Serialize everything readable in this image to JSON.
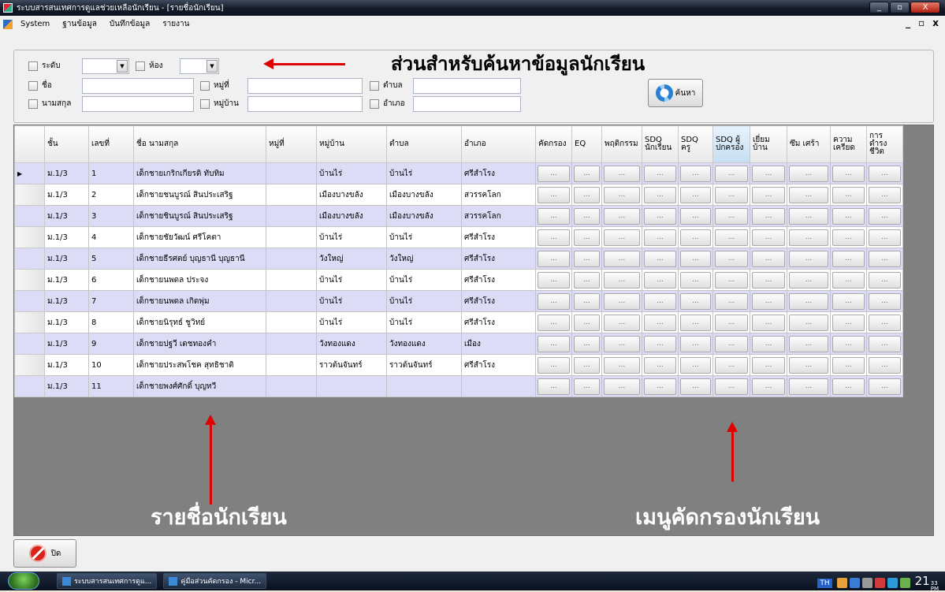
{
  "window": {
    "title": "ระบบสารสนเทศการดูแลช่วยเหลือนักเรียน - [รายชื่อนักเรียน]",
    "min_label": "_",
    "max_label": "▫",
    "close_label": "X"
  },
  "menubar": {
    "items": [
      "System",
      "ฐานข้อมูล",
      "บันทึกข้อมูล",
      "รายงาน"
    ],
    "mdi_min": "_",
    "mdi_restore": "▫",
    "mdi_close": "x"
  },
  "search": {
    "level_label": "ระดับ",
    "room_label": "ห้อง",
    "name_label": "ชื่อ",
    "moo_label": "หมู่ที่",
    "tambon_label": "ตำบล",
    "surname_label": "นามสกุล",
    "village_label": "หมู่บ้าน",
    "amphoe_label": "อำเภอ",
    "search_button": "ค้นหา"
  },
  "annotations": {
    "search_note": "ส่วนสำหรับค้นหาข้อมูลนักเรียน",
    "list_note": "รายชื่อนักเรียน",
    "filter_note": "เมนูคัดกรองนักเรียน"
  },
  "grid": {
    "columns": [
      "ชั้น",
      "เลขที่",
      "ชื่อ นามสกุล",
      "หมู่ที่",
      "หมู่บ้าน",
      "ตำบล",
      "อำเภอ",
      "คัดกรอง",
      "EQ",
      "พฤติกรรม",
      "SDQ นักเรียน",
      "SDQ ครู",
      "SDQ ผู้ปกครอง",
      "เยี่ยม บ้าน",
      "ซึม เศร้า",
      "ความ เครียด",
      "การ ดำรง ชีวิต"
    ],
    "button_label": "...",
    "rows": [
      {
        "grade": "ม.1/3",
        "no": "1",
        "name": "เด็กชายเกริกเกียรติ ทับทิม",
        "moo": "",
        "village": "บ้านไร่",
        "tambon": "บ้านไร่",
        "amphoe": "ศรีสำโรง"
      },
      {
        "grade": "ม.1/3",
        "no": "2",
        "name": "เด็กชายชนบูรณ์ สินประเสริฐ",
        "moo": "",
        "village": "เมืองบางขลัง",
        "tambon": "เมืองบางขลัง",
        "amphoe": "สวรรคโลก"
      },
      {
        "grade": "ม.1/3",
        "no": "3",
        "name": "เด็กชายชินบูรณ์ สินประเสริฐ",
        "moo": "",
        "village": "เมืองบางขลัง",
        "tambon": "เมืองบางขลัง",
        "amphoe": "สวรรคโลก"
      },
      {
        "grade": "ม.1/3",
        "no": "4",
        "name": "เด็กชายชัยวัฒน์ ศรีโคตา",
        "moo": "",
        "village": "บ้านไร่",
        "tambon": "บ้านไร่",
        "amphoe": "ศรีสำโรง"
      },
      {
        "grade": "ม.1/3",
        "no": "5",
        "name": "เด็กชายธีรศตย์ บุญธานี บุญธานี",
        "moo": "",
        "village": "วังใหญ่",
        "tambon": "วังใหญ่",
        "amphoe": "ศรีสำโรง"
      },
      {
        "grade": "ม.1/3",
        "no": "6",
        "name": "เด็กชายนพดล ประจง",
        "moo": "",
        "village": "บ้านไร่",
        "tambon": "บ้านไร่",
        "amphoe": "ศรีสำโรง"
      },
      {
        "grade": "ม.1/3",
        "no": "7",
        "name": "เด็กชายนพดล เกิดพุ่ม",
        "moo": "",
        "village": "บ้านไร่",
        "tambon": "บ้านไร่",
        "amphoe": "ศรีสำโรง"
      },
      {
        "grade": "ม.1/3",
        "no": "8",
        "name": "เด็กชายนิรุทธ์ ชูวิทย์",
        "moo": "",
        "village": "บ้านไร่",
        "tambon": "บ้านไร่",
        "amphoe": "ศรีสำโรง"
      },
      {
        "grade": "ม.1/3",
        "no": "9",
        "name": "เด็กชายปฐวี เดชทองคำ",
        "moo": "",
        "village": "วังทองแดง",
        "tambon": "วังทองแดง",
        "amphoe": "เมือง"
      },
      {
        "grade": "ม.1/3",
        "no": "10",
        "name": "เด็กชายประสพโชค สุทธิชาติ",
        "moo": "",
        "village": "ราวต้นจันทร์",
        "tambon": "ราวต้นจันทร์",
        "amphoe": "ศรีสำโรง"
      },
      {
        "grade": "ม.1/3",
        "no": "11",
        "name": "เด็กชายพงศ์ศักดิ์ บุญทวี",
        "moo": "",
        "village": "",
        "tambon": "",
        "amphoe": ""
      }
    ]
  },
  "close_button": "ปิด",
  "taskbar": {
    "tasks": [
      "ระบบสารสนเทศการดูแ...",
      "คู่มือส่วนคัดกรอง - Micr..."
    ],
    "lang": "TH",
    "time": "21",
    "minutes": "33",
    "ampm": "PM"
  },
  "colors": {
    "arrow": "#e00000",
    "row_alt": "#dcdcf7",
    "grid_bg": "#808080"
  }
}
